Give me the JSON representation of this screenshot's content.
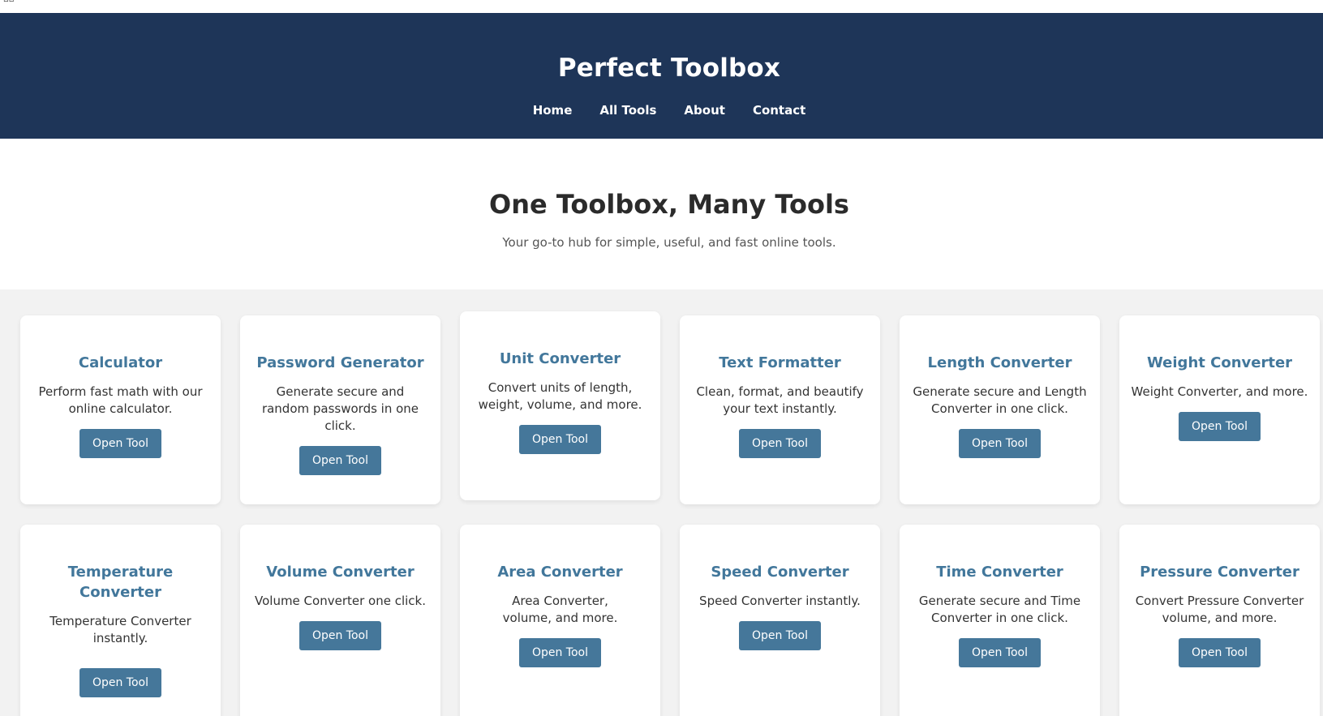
{
  "corner_glyph": "▫▫",
  "header": {
    "title": "Perfect Toolbox",
    "nav": [
      "Home",
      "All Tools",
      "About",
      "Contact"
    ]
  },
  "hero": {
    "heading": "One Toolbox, Many Tools",
    "subtitle": "Your go-to hub for simple, useful, and fast online tools."
  },
  "tools": [
    {
      "title": "Calculator",
      "desc": "Perform fast math with our online calculator.",
      "button": "Open Tool"
    },
    {
      "title": "Password Generator",
      "desc": "Generate secure and random passwords in one click.",
      "button": "Open Tool"
    },
    {
      "title": "Unit Converter",
      "desc": "Convert units of length, weight, volume, and more.",
      "button": "Open Tool"
    },
    {
      "title": "Text Formatter",
      "desc": "Clean, format, and beautify your text instantly.",
      "button": "Open Tool"
    },
    {
      "title": "Length Converter",
      "desc": "Generate secure and Length Converter in one click.",
      "button": "Open Tool"
    },
    {
      "title": "Weight Converter",
      "desc": "Weight Converter, and more.",
      "button": "Open Tool"
    },
    {
      "title": "Temperature Converter",
      "desc": "Temperature Converter instantly.",
      "button": "Open Tool"
    },
    {
      "title": "Volume Converter",
      "desc": "Volume Converter one click.",
      "button": "Open Tool"
    },
    {
      "title": "Area Converter",
      "desc": "Area Converter, volume, and more.",
      "button": "Open Tool"
    },
    {
      "title": "Speed Converter",
      "desc": "Speed Converter instantly.",
      "button": "Open Tool"
    },
    {
      "title": "Time Converter",
      "desc": "Generate secure and Time Converter in one click.",
      "button": "Open Tool"
    },
    {
      "title": "Pressure Converter",
      "desc": "Convert Pressure Converter volume, and more.",
      "button": "Open Tool"
    }
  ]
}
